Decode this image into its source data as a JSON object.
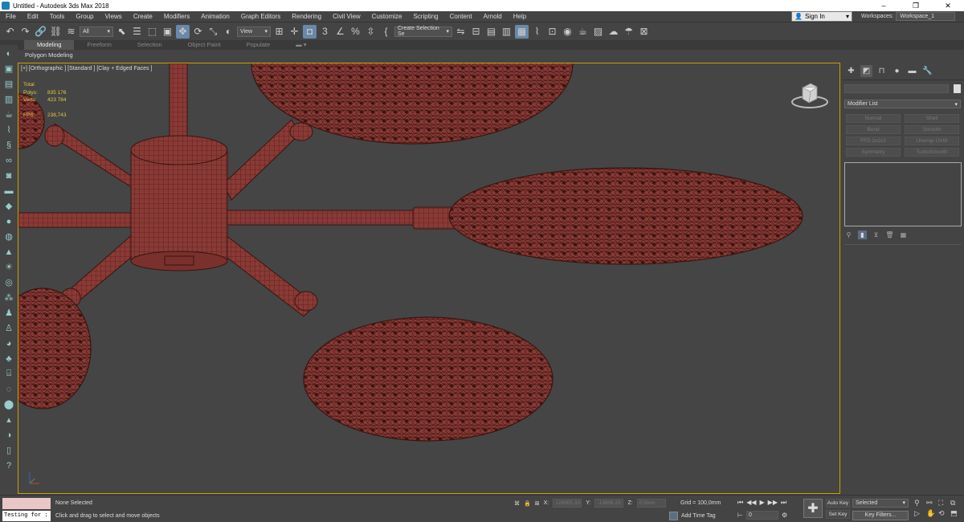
{
  "window": {
    "title": "Untitled - Autodesk 3ds Max 2018",
    "controls": [
      "–",
      "❐",
      "✕"
    ]
  },
  "menu": [
    "File",
    "Edit",
    "Tools",
    "Group",
    "Views",
    "Create",
    "Modifiers",
    "Animation",
    "Graph Editors",
    "Rendering",
    "Civil View",
    "Customize",
    "Scripting",
    "Content",
    "Arnold",
    "Help"
  ],
  "account": {
    "sign_in": "Sign In",
    "workspaces_label": "Workspaces:",
    "workspace": "Workspace_1"
  },
  "toolbar": {
    "filter": "All",
    "ref_coord": "View",
    "selection_set": "Create Selection Se",
    "snap_label": "3",
    "percent_label": "%"
  },
  "ribbon": {
    "tabs": [
      "Modeling",
      "Freeform",
      "Selection",
      "Object Paint",
      "Populate"
    ],
    "active_tab": "Modeling",
    "panel_label": "Polygon Modeling"
  },
  "viewport": {
    "label": "[+] [Orthographic ] [Standard ] [Clay + Edged Faces ]",
    "stats": {
      "total_label": "Total",
      "polys_label": "Polys:",
      "polys": "835 176",
      "verts_label": "Verts:",
      "verts": "423 784",
      "fps_label": "FPS:",
      "fps": "238,743"
    }
  },
  "command_panel": {
    "modifier_list": "Modifier List",
    "modifiers": [
      "Normal",
      "Shell",
      "Bend",
      "Smooth",
      "FFD 2x2x2",
      "Unwrap UVW",
      "Symmetry",
      "TurboSmooth"
    ]
  },
  "status": {
    "script_text": "Testing for :",
    "selection": "None Selected",
    "hint": "Click and drag to select and move objects",
    "x_label": "X:",
    "x": "128905,33",
    "y_label": "Y:",
    "y": "-13806,29",
    "z_label": "Z:",
    "z": "0,0mm",
    "grid": "Grid = 100,0mm",
    "add_time_tag": "Add Time Tag",
    "frame": "0",
    "auto_key": "Auto Key",
    "set_key": "Set Key",
    "key_mode": "Selected",
    "key_filters": "Key Filters..."
  },
  "colors": {
    "viewport_bg": "#454545",
    "model_fill": "#8a3a36",
    "wire": "#3a1410",
    "viewport_border": "#c8a000",
    "stats_text": "#e6c840"
  }
}
